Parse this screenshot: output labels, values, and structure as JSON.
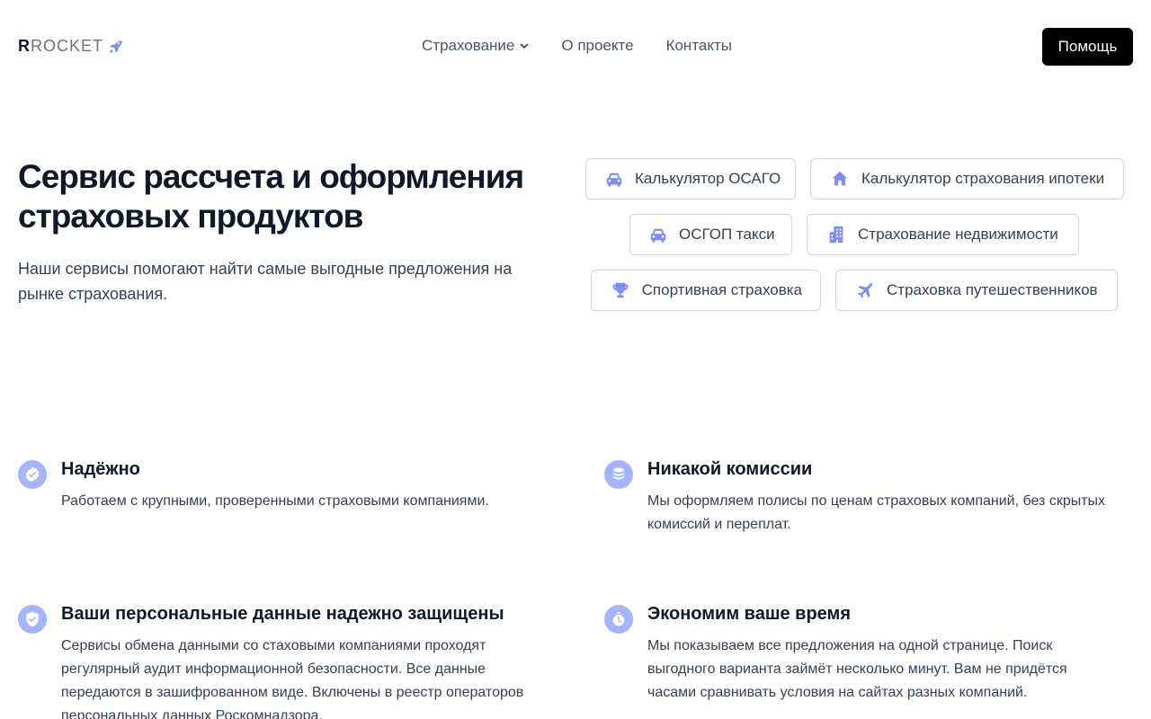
{
  "header": {
    "logo_first": "R",
    "logo_rest": "ROCKET",
    "nav": [
      "Страхование",
      "О проекте",
      "Контакты"
    ],
    "help_label": "Помощь"
  },
  "hero": {
    "title": "Сервис рассчета и оформления страховых продуктов",
    "subtitle": "Наши сервисы помогают найти самые выгодные предложения на рынке страхования."
  },
  "products": [
    {
      "label": "Калькулятор ОСАГО",
      "icon": "car-icon"
    },
    {
      "label": "Калькулятор страхования ипотеки",
      "icon": "home-icon"
    },
    {
      "label": "ОСГОП такси",
      "icon": "car-icon"
    },
    {
      "label": "Страхование недвижимости",
      "icon": "building-icon"
    },
    {
      "label": "Спортивная страховка",
      "icon": "trophy-icon"
    },
    {
      "label": "Страховка путешественников",
      "icon": "airplane-icon"
    }
  ],
  "features": [
    {
      "title": "Надёжно",
      "text": "Работаем с крупными, проверенными страховыми компаниями.",
      "icon": "check-badge-icon"
    },
    {
      "title": "Никакой комиссии",
      "text": "Мы оформляем полисы по ценам страховых компаний, без скрытых комиссий и переплат.",
      "icon": "coins-icon"
    },
    {
      "title": "Ваши персональные данные надежно защищены",
      "text": "Сервисы обмена данными со стаховыми компаниями проходят регулярный аудит информационной безопасности. Все данные передаются в зашифрованном виде. Включены в реестр операторов персональных данных Роскомнадзора.",
      "icon": "shield-check-icon"
    },
    {
      "title": "Экономим ваше время",
      "text": "Мы показываем все предложения на одной странице. Поиск выгодного варианта займёт несколько минут. Вам не придётся часами сравнивать условия на сайтах разных компаний.",
      "icon": "stopwatch-icon"
    }
  ],
  "colors": {
    "accent": "#a5b4fc",
    "icon": "#818cf8",
    "help_button": "#000000"
  }
}
